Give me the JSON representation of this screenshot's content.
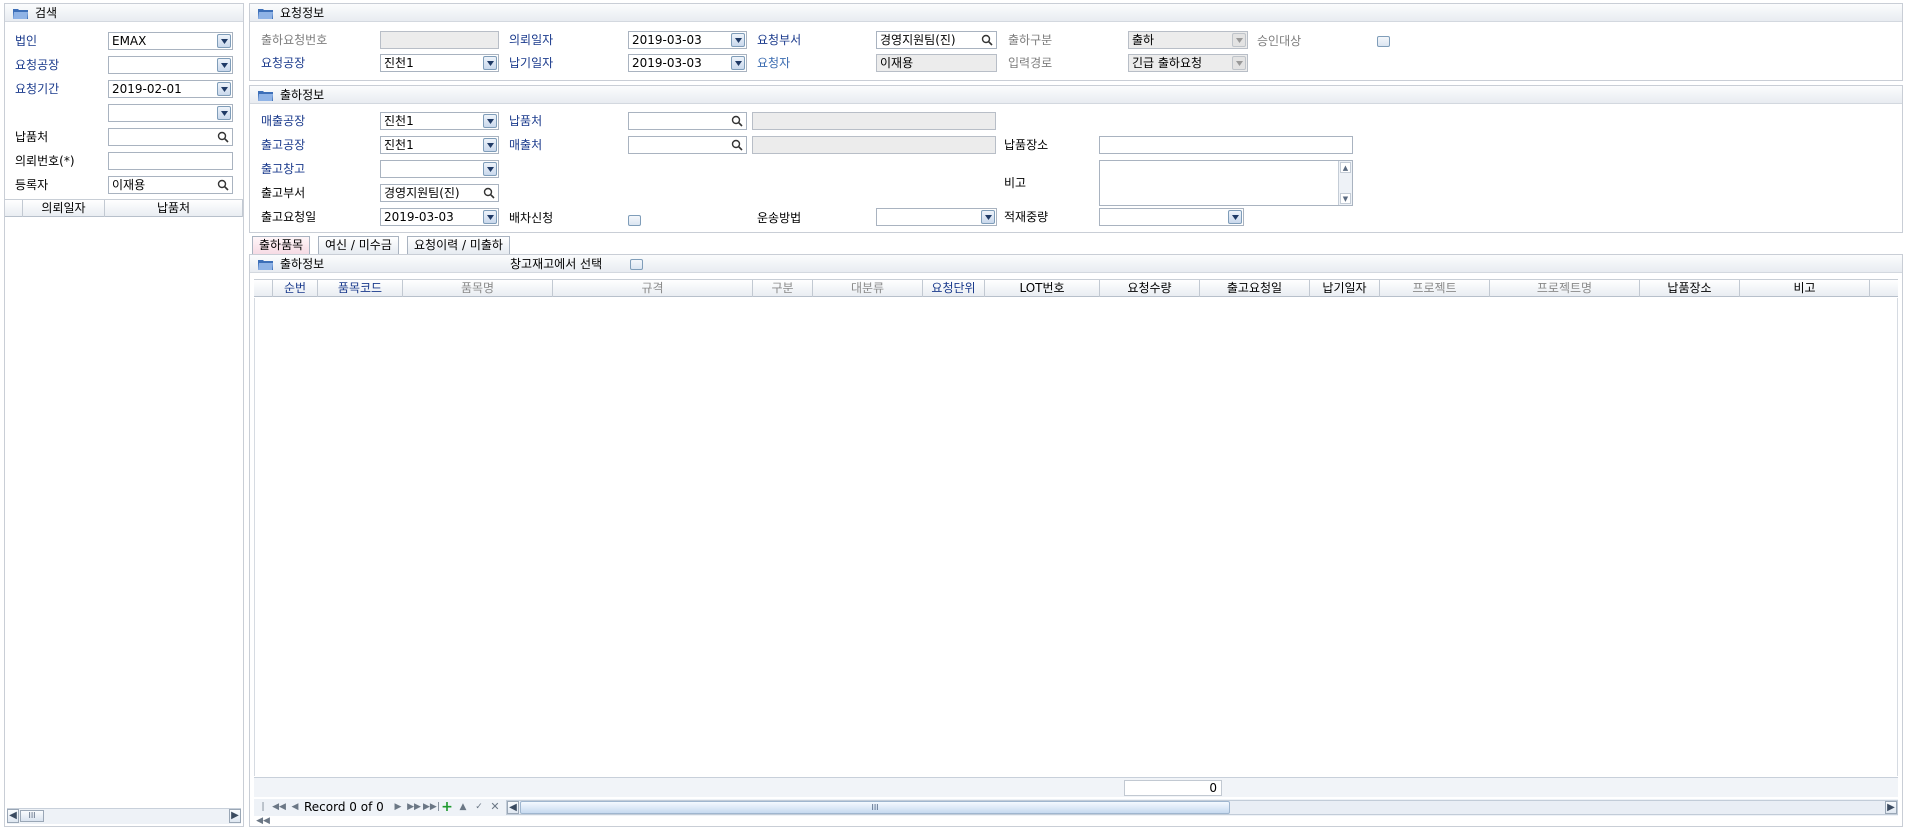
{
  "search": {
    "title": "검색",
    "corp_label": "법인",
    "corp_value": "EMAX",
    "factory_label": "요청공장",
    "factory_value": "",
    "period_label": "요청기간",
    "period_from": "2019-02-01",
    "period_to": "",
    "delivery_label": "납품처",
    "delivery_value": "",
    "reqno_label": "의뢰번호(*)",
    "reqno_value": "",
    "register_label": "등록자",
    "register_value": "이재용",
    "grid_headers": [
      "의뢰일자",
      "납품처"
    ],
    "scroll_thumb": "III"
  },
  "request": {
    "title": "요청정보",
    "shipreq_no_label": "출하요청번호",
    "shipreq_no_value": "",
    "req_date_label": "의뢰일자",
    "req_date_value": "2019-03-03",
    "req_dept_label": "요청부서",
    "req_dept_value": "경영지원팀(진)",
    "ship_type_label": "출하구분",
    "ship_type_value": "출하",
    "approval_label": "승인대상",
    "req_factory_label": "요청공장",
    "req_factory_value": "진천1",
    "due_date_label": "납기일자",
    "due_date_value": "2019-03-03",
    "requester_label": "요청자",
    "requester_value": "이재용",
    "input_path_label": "입력경로",
    "input_path_value": "긴급 출하요청"
  },
  "shipping": {
    "title": "출하정보",
    "sales_factory_label": "매출공장",
    "sales_factory_value": "진천1",
    "delivery_to_label": "납품처",
    "delivery_to_value": "",
    "delivery_to_name": "",
    "out_factory_label": "출고공장",
    "out_factory_value": "진천1",
    "sales_to_label": "매출처",
    "sales_to_value": "",
    "sales_to_name": "",
    "delivery_place_label": "납품장소",
    "delivery_place_value": "",
    "out_warehouse_label": "출고창고",
    "out_warehouse_value": "",
    "remark_label": "비고",
    "remark_value": "",
    "out_dept_label": "출고부서",
    "out_dept_value": "경영지원팀(진)",
    "out_req_date_label": "출고요청일",
    "out_req_date_value": "2019-03-03",
    "dispatch_label": "배차신청",
    "transport_label": "운송방법",
    "transport_value": "",
    "load_weight_label": "적재중량",
    "load_weight_value": ""
  },
  "tabs": [
    {
      "label": "출하품목"
    },
    {
      "label": "여신 / 미수금"
    },
    {
      "label": "요청이력 / 미출하"
    }
  ],
  "items": {
    "title": "출하정보",
    "stock_select_label": "창고재고에서 선택",
    "columns": [
      {
        "label": "순번",
        "style": "blue"
      },
      {
        "label": "품목코드",
        "style": "blue"
      },
      {
        "label": "품목명",
        "style": "gray"
      },
      {
        "label": "규격",
        "style": "gray"
      },
      {
        "label": "구분",
        "style": "gray"
      },
      {
        "label": "대분류",
        "style": "gray"
      },
      {
        "label": "요청단위",
        "style": "blue"
      },
      {
        "label": "LOT번호",
        "style": "normal"
      },
      {
        "label": "요청수량",
        "style": "normal"
      },
      {
        "label": "출고요청일",
        "style": "normal"
      },
      {
        "label": "납기일자",
        "style": "normal"
      },
      {
        "label": "프로젝트",
        "style": "gray"
      },
      {
        "label": "프로젝트명",
        "style": "gray"
      },
      {
        "label": "납품장소",
        "style": "normal"
      },
      {
        "label": "비고",
        "style": "normal"
      }
    ],
    "total": "0",
    "record_text": "Record 0 of 0",
    "scroll_thumb": "III"
  },
  "colors": {
    "label_blue": "#1a3a8c",
    "border": "#a9b3c0",
    "readonly_bg": "#ececec"
  }
}
